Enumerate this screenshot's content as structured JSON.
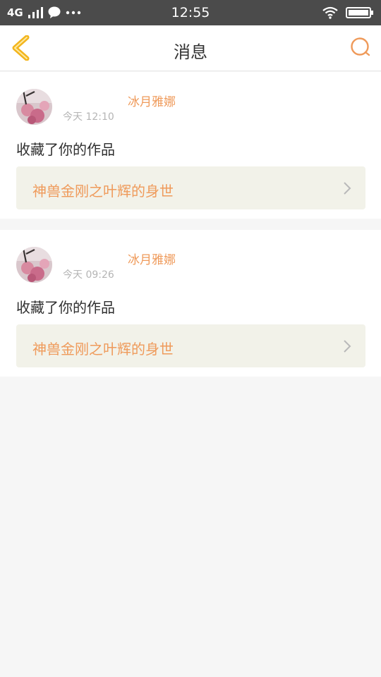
{
  "status_bar": {
    "network": "4G",
    "time": "12:55"
  },
  "header": {
    "back_icon": "chevron-left-icon",
    "title": "消息",
    "search_icon": "search-icon"
  },
  "colors": {
    "accent": "#ef9a5a",
    "card_link_bg": "#f2f2e9",
    "page_bg": "#f6f6f6",
    "status_bar": "#4b4b4b"
  },
  "messages": [
    {
      "user": "冰月雅娜",
      "time": "今天 12:10",
      "action": "收藏了你的作品",
      "work_title": "神兽金刚之叶辉的身世"
    },
    {
      "user": "冰月雅娜",
      "time": "今天 09:26",
      "action": "收藏了你的作品",
      "work_title": "神兽金刚之叶辉的身世"
    }
  ]
}
